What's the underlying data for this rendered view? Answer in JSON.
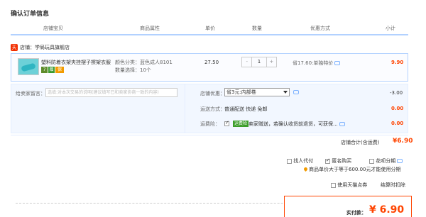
{
  "page": {
    "title": "确认订单信息"
  },
  "columns": [
    "店铺宝贝",
    "商品属性",
    "单价",
    "数量",
    "优惠方式",
    "小计"
  ],
  "store": {
    "icon_label": "天",
    "name": "店铺：学局玩具旗舰店"
  },
  "item": {
    "title": "塑料防着衣架夹挂摆子擦架衣服",
    "attr_color": "颜色分类：蓝色成人8101",
    "attr_qty": "数量选择：10个",
    "price": "27.50",
    "qty_minus": "-",
    "quantity": "1",
    "qty_plus": "+",
    "promo": "省17.60:单独特价",
    "subtotal": "9.90",
    "badges": [
      "7",
      "赠",
      "保"
    ]
  },
  "options": {
    "message_label": "给卖家留言：",
    "message_placeholder": "选填:对本次交易的说明(建议填写已和卖家协商一致的内容)",
    "shop_discount_label": "店铺优惠：",
    "shop_discount_value": "省3元:内部卷",
    "shop_discount_amount": "-3.00",
    "shipping_label": "运送方式：",
    "shipping_value": "普通配送 快递 免邮",
    "shipping_amount": "0.00",
    "insurance_label": "运费险：",
    "insurance_badge": "运费险",
    "insurance_text": "卖家赠送，若确认收货前退货，可获保...",
    "insurance_amount": "0.00"
  },
  "store_total": {
    "label": "店铺合计(含运费)",
    "value": "¥6.90"
  },
  "checkout_options": {
    "proxy": "找人代付",
    "anonymous": "匿名购买",
    "huabei": "花呗分期"
  },
  "huabei_note": "商品单价大于等于600.00元才能使用分期",
  "tmall": {
    "points": "使用天猫点券",
    "settle": "结算时扣除"
  },
  "payment": {
    "label": "实付款：",
    "value": "¥ 6.90"
  },
  "colors": {
    "accent": "#ff4400",
    "border": "#b2d1ff",
    "panel": "#f2f7ff"
  }
}
